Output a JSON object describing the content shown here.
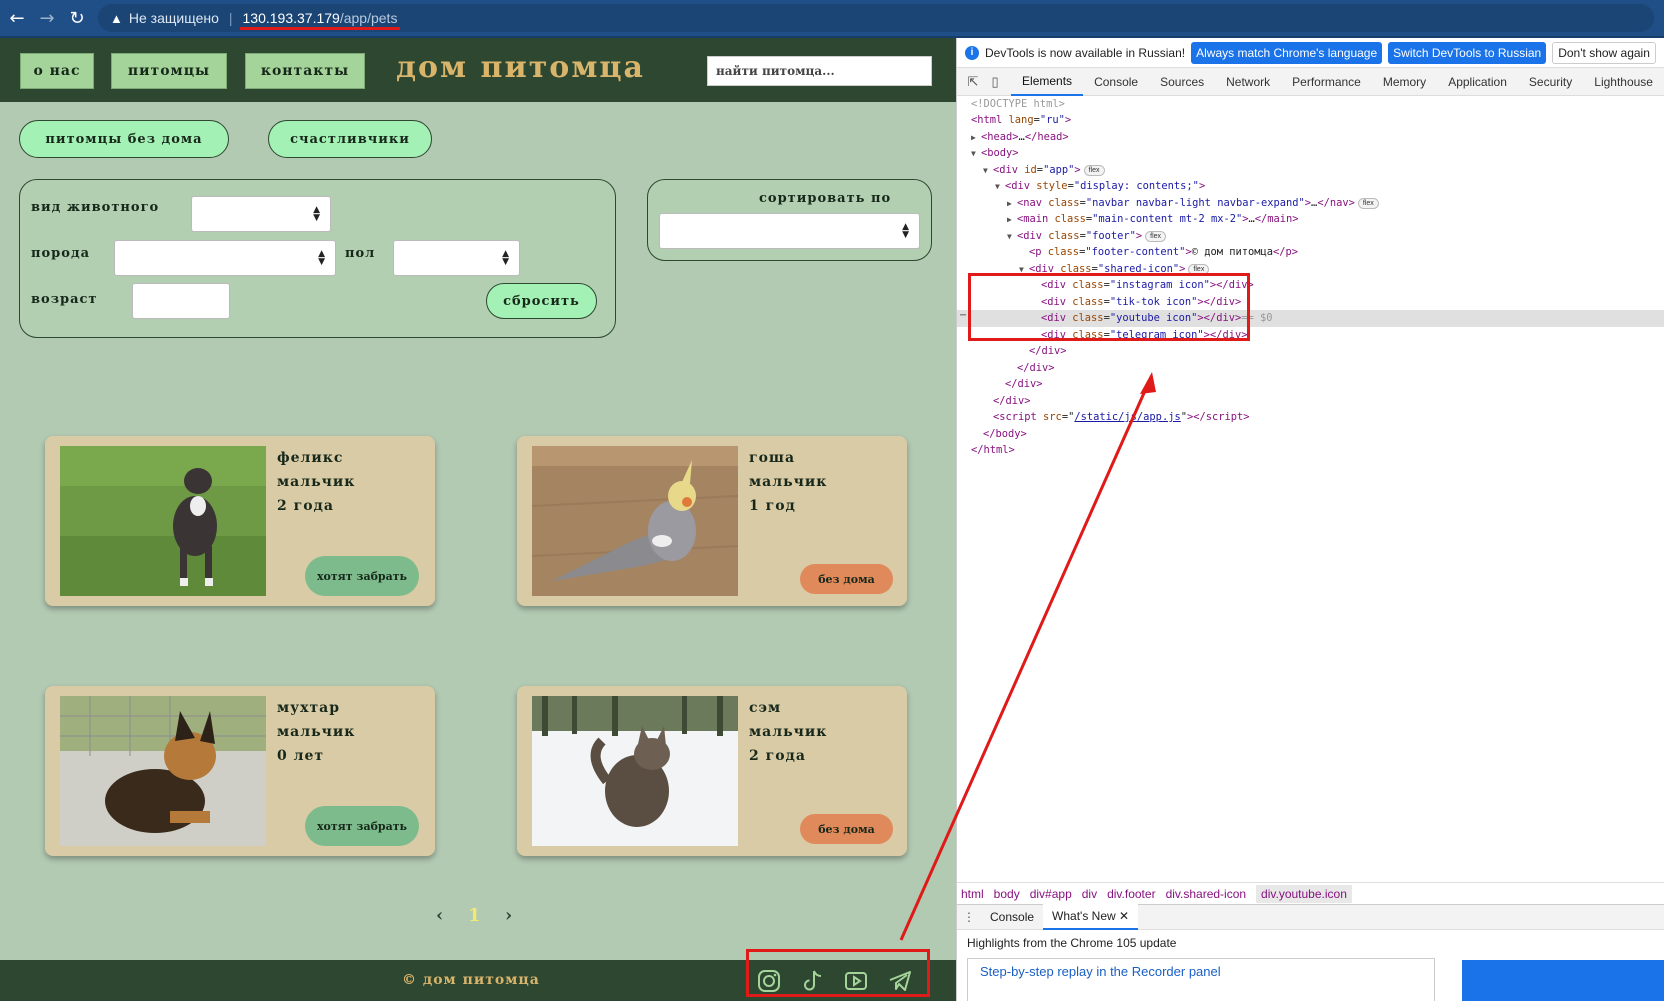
{
  "browser": {
    "security_label": "Не защищено",
    "url_host": "130.193.37.179",
    "url_path": "/app/pets"
  },
  "navbar": {
    "about_label": "о нас",
    "pets_label": "питомцы",
    "contacts_label": "контакты",
    "brand": "дом питомца",
    "search_placeholder": "найти питомца..."
  },
  "filters": {
    "homeless_label": "питомцы без дома",
    "lucky_label": "счастливчики",
    "species_label": "вид животного",
    "breed_label": "порода",
    "sex_label": "пол",
    "age_label": "возраст",
    "reset_label": "сбросить",
    "sort_label": "сортировать по"
  },
  "pets": [
    {
      "name": "феликс",
      "sex": "мальчик",
      "age": "2 года",
      "status": "хотят забрать",
      "status_kind": "green",
      "photo": "dog-pitbull"
    },
    {
      "name": "гоша",
      "sex": "мальчик",
      "age": "1 год",
      "status": "без дома",
      "status_kind": "orange",
      "photo": "cockatiel"
    },
    {
      "name": "мухтар",
      "sex": "мальчик",
      "age": "0 лет",
      "status": "хотят забрать",
      "status_kind": "green",
      "photo": "puppy-shepherd"
    },
    {
      "name": "сэм",
      "sex": "мальчик",
      "age": "2 года",
      "status": "без дома",
      "status_kind": "orange",
      "photo": "cat-snow"
    }
  ],
  "pager": {
    "prev": "‹",
    "current": "1",
    "next": "›"
  },
  "footer": {
    "text": "© дом питомца",
    "icons": [
      "instagram-icon",
      "tik-tok-icon",
      "youtube-icon",
      "telegram-icon"
    ]
  },
  "devtools": {
    "info_text": "DevTools is now available in Russian!",
    "btn_match": "Always match Chrome's language",
    "btn_switch": "Switch DevTools to Russian",
    "btn_dont": "Don't show again",
    "tabs": [
      "Elements",
      "Console",
      "Sources",
      "Network",
      "Performance",
      "Memory",
      "Application",
      "Security",
      "Lighthouse"
    ],
    "active_tab": "Elements",
    "selected_marker": "== $0",
    "breadcrumbs": [
      "html",
      "body",
      "div#app",
      "div",
      "div.footer",
      "div.shared-icon",
      "div.youtube.icon"
    ],
    "drawer_tabs": [
      "Console",
      "What's New"
    ],
    "highlights": "Highlights from the Chrome 105 update",
    "whats_new_item": "Step-by-step replay in the Recorder panel"
  },
  "colors": {
    "navbar_bg": "#2e4731",
    "page_bg": "#b2c9b2",
    "card_bg": "#d9cba5",
    "accent_gold": "#d9b46b",
    "status_green": "#7dbb8c",
    "status_orange": "#e08a5c",
    "annotation_red": "#e01919"
  }
}
